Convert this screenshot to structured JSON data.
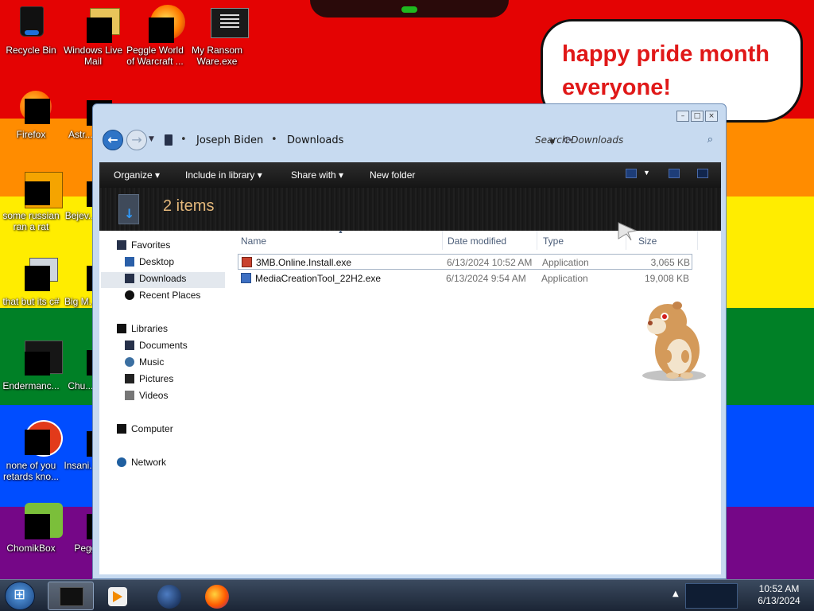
{
  "desktop": {
    "icons": [
      {
        "label": "Recycle Bin"
      },
      {
        "label": "Windows Live Mail"
      },
      {
        "label": "Peggle World of Warcraft ..."
      },
      {
        "label": "My Ransom Ware.exe"
      },
      {
        "label": "Firefox"
      },
      {
        "label": "Astr... Del..."
      },
      {
        "label": "some russian ran a rat"
      },
      {
        "label": "Bejev... Del..."
      },
      {
        "label": "that but its c#"
      },
      {
        "label": "Big M... Del..."
      },
      {
        "label": "Endermanc..."
      },
      {
        "label": "Chu... Del..."
      },
      {
        "label": "none of you retards kno..."
      },
      {
        "label": "Insani... Del..."
      },
      {
        "label": "ChomikBox"
      },
      {
        "label": "Peggle..."
      }
    ],
    "bubble_text": "happy pride month everyone!"
  },
  "window": {
    "breadcrumb": [
      "Joseph Biden",
      "Downloads"
    ],
    "search_placeholder": "Search Downloads",
    "toolbar": {
      "organize": "Organize ▾",
      "include": "Include in library ▾",
      "share": "Share with ▾",
      "new_folder": "New folder"
    },
    "item_count": "2 items",
    "nav": {
      "favorites": "Favorites",
      "desktop": "Desktop",
      "downloads": "Downloads",
      "recent": "Recent Places",
      "libraries": "Libraries",
      "documents": "Documents",
      "music": "Music",
      "pictures": "Pictures",
      "videos": "Videos",
      "computer": "Computer",
      "network": "Network"
    },
    "columns": {
      "name": "Name",
      "date": "Date modified",
      "type": "Type",
      "size": "Size"
    },
    "files": [
      {
        "name": "3MB.Online.Install.exe",
        "date": "6/13/2024 10:52 AM",
        "type": "Application",
        "size": "3,065 KB"
      },
      {
        "name": "MediaCreationTool_22H2.exe",
        "date": "6/13/2024 9:54 AM",
        "type": "Application",
        "size": "19,008 KB"
      }
    ]
  },
  "taskbar": {
    "time": "10:52 AM",
    "date": "6/13/2024"
  },
  "colors": {
    "accent": "#2f74c6",
    "header_text": "#e3b77a",
    "bubble_text": "#e01818"
  }
}
